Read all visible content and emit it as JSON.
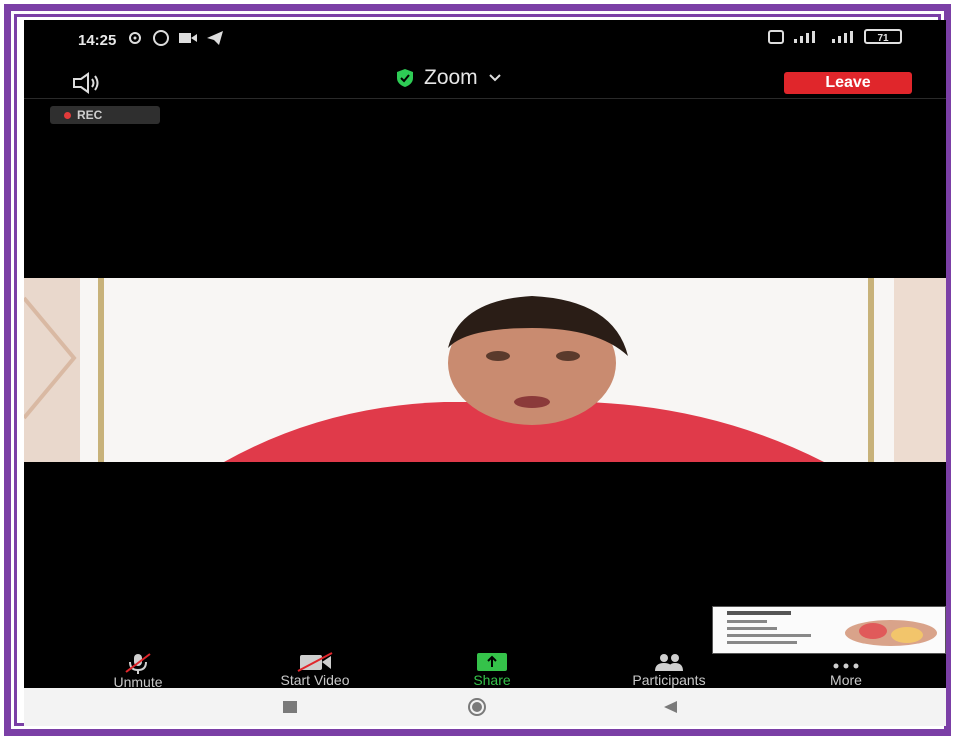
{
  "status_bar": {
    "time": "14:25",
    "battery": "71"
  },
  "header": {
    "title": "Zoom",
    "leave_label": "Leave",
    "rec_label": "REC"
  },
  "toolbar": {
    "unmute_label": "Unmute",
    "start_video_label": "Start Video",
    "share_label": "Share",
    "participants_label": "Participants",
    "more_label": "More"
  },
  "colors": {
    "frame": "#7b3fa6",
    "leave": "#e0262b",
    "share": "#35c24a",
    "shield": "#2ecc55"
  },
  "icons": [
    "speaker-icon",
    "shield-icon",
    "chevron-down-icon",
    "mic-off-icon",
    "video-off-icon",
    "share-icon",
    "participants-icon",
    "more-icon"
  ]
}
